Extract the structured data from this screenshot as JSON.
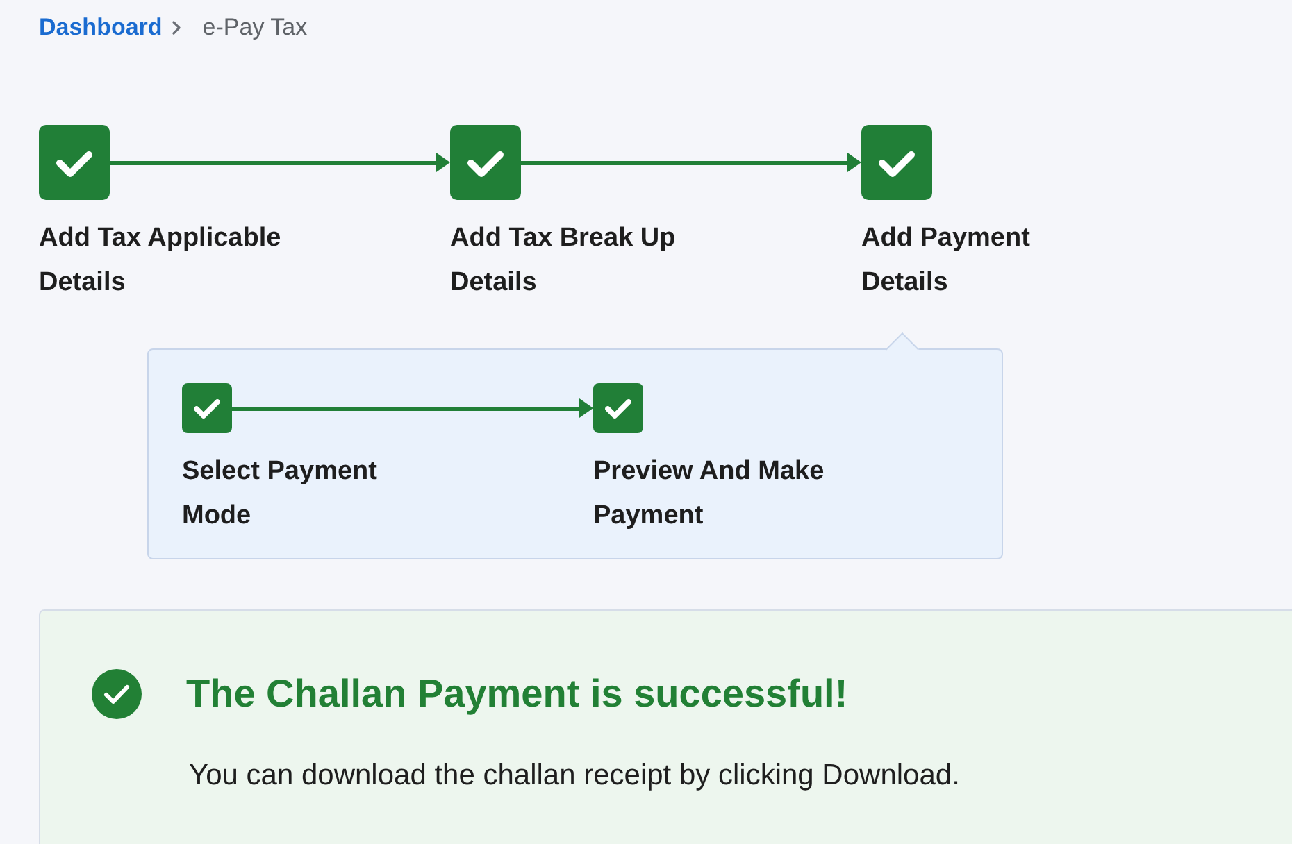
{
  "breadcrumb": [
    {
      "label": "Dashboard",
      "kind": "link"
    },
    {
      "label": "e-Pay Tax",
      "kind": "current"
    }
  ],
  "steps": [
    {
      "label": "Add Tax Applicable Details",
      "completed": true
    },
    {
      "label": "Add Tax Break Up Details",
      "completed": true
    },
    {
      "label": "Add Payment Details",
      "completed": true,
      "sub_steps": [
        {
          "label": "Select Payment Mode",
          "completed": true
        },
        {
          "label": "Preview And Make Payment",
          "completed": true
        }
      ]
    }
  ],
  "result": {
    "kind": "success",
    "title": "The Challan Payment is successful!",
    "message": "You can download the challan receipt by clicking Download."
  }
}
